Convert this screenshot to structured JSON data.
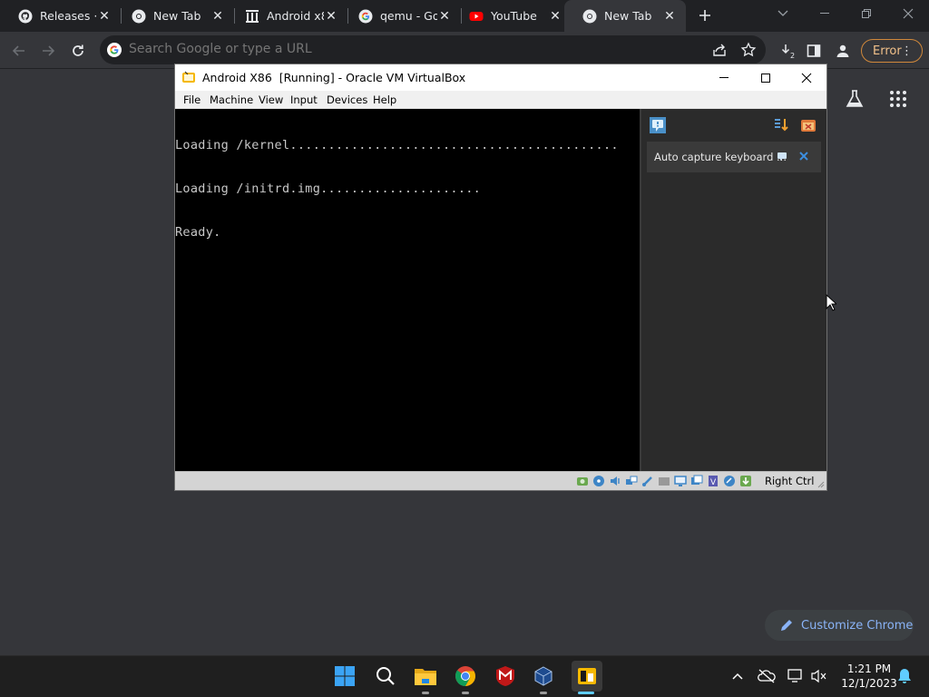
{
  "browser": {
    "tabs": [
      {
        "title": "Releases · ",
        "favicon": "github-icon"
      },
      {
        "title": "New Tab",
        "favicon": "chrome-icon"
      },
      {
        "title": "Android x86",
        "favicon": "archive-icon"
      },
      {
        "title": "qemu - Go",
        "favicon": "google-icon"
      },
      {
        "title": "YouTube",
        "favicon": "youtube-icon"
      },
      {
        "title": "New Tab",
        "favicon": "chrome-icon"
      }
    ],
    "omnibox_placeholder": "Search Google or type a URL",
    "error_label": "Error",
    "customize_label": "Customize Chrome"
  },
  "vbox": {
    "title": "Android X86  [Running] - Oracle VM VirtualBox",
    "menu": [
      "File",
      "Machine",
      "View",
      "Input",
      "Devices",
      "Help"
    ],
    "console_lines": [
      "Loading /kernel...........................................",
      "Loading /initrd.img.....................",
      "Ready."
    ],
    "notification": "Auto capture keyboard ...",
    "host_key": "Right Ctrl"
  },
  "taskbar": {
    "time": "1:21 PM",
    "date": "12/1/2023"
  },
  "colors": {
    "chrome_bg": "#35363a",
    "tabstrip_bg": "#202124",
    "accent_blue": "#8ab4f8",
    "error_orange": "#d0883b"
  }
}
